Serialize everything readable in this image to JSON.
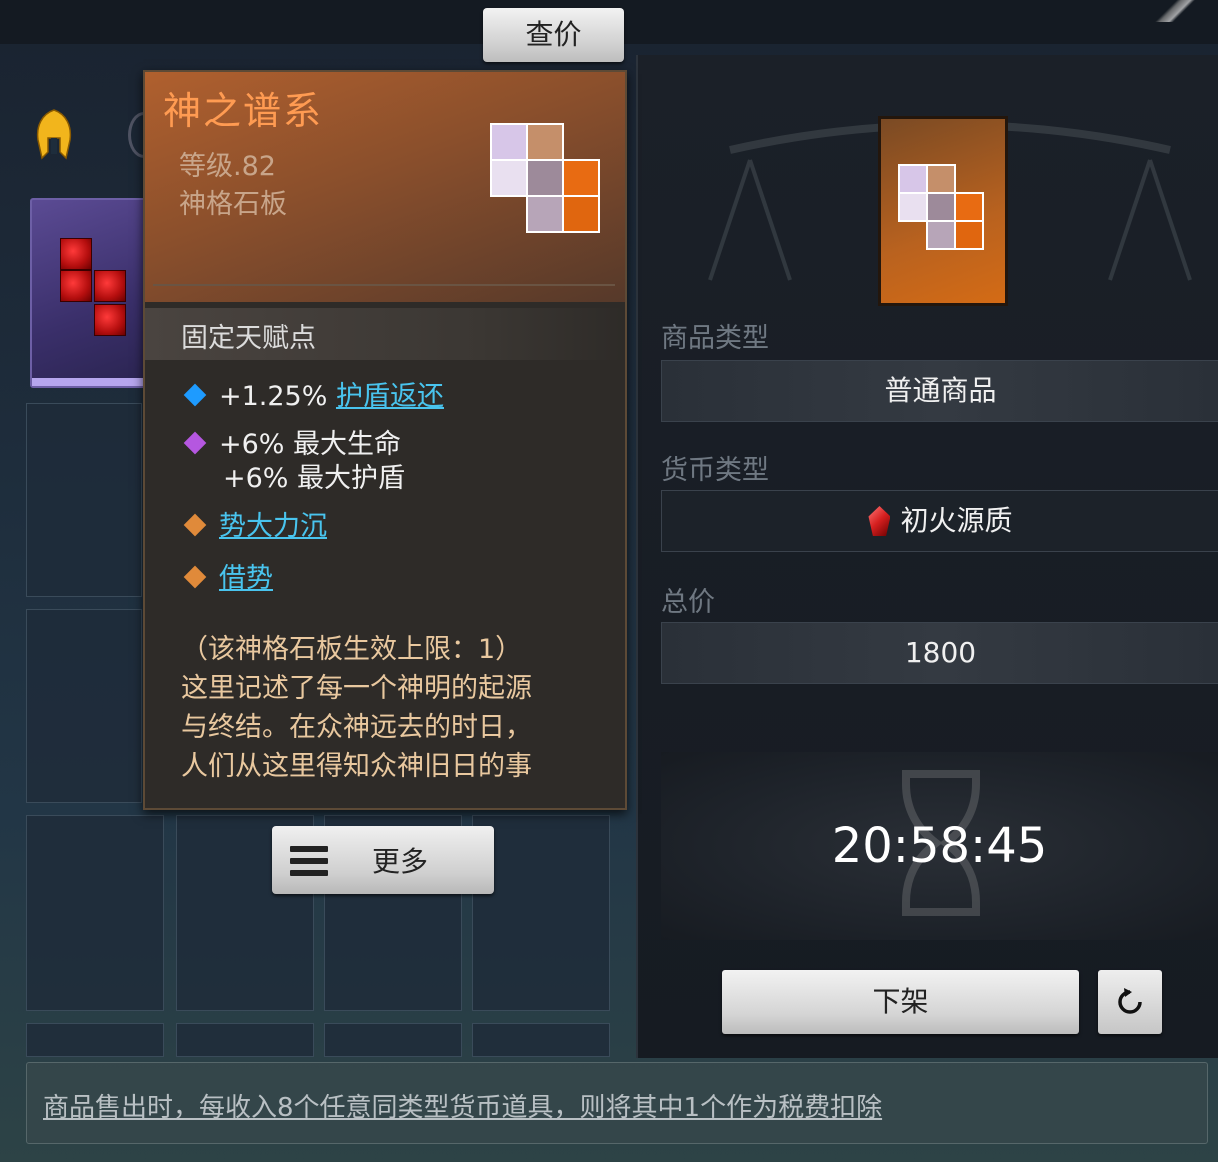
{
  "header": {
    "check_price_label": "查价"
  },
  "tooltip": {
    "title": "神之谱系",
    "level": "等级.82",
    "item_type": "神格石板",
    "section_title": "固定天赋点",
    "talents": [
      {
        "prefix": "+1.25% ",
        "link": "护盾返还",
        "color": "#1e9bff"
      },
      {
        "line1": "+6% 最大生命",
        "line2": "+6% 最大护盾",
        "color": "#b557e0"
      },
      {
        "link": "势大力沉",
        "color": "#e08a3a"
      },
      {
        "link": "借势",
        "color": "#e08a3a"
      }
    ],
    "description_lines": [
      "（该神格石板生效上限：1）",
      "这里记述了每一个神明的起源",
      "与终结。在众神远去的时日，",
      "人们从这里得知众神旧日的事"
    ]
  },
  "more_button": {
    "label": "更多",
    "icon": "menu-icon"
  },
  "listing": {
    "item_type_label": "商品类型",
    "item_type_value": "普通商品",
    "currency_label": "货币类型",
    "currency_value": "初火源质",
    "currency_icon": "red-crystal-icon",
    "total_label": "总价",
    "total_value": "1800",
    "timer": "20:58:45",
    "delist_label": "下架",
    "refresh_icon": "refresh-icon"
  },
  "footer": {
    "notice": "商品售出时，每收入8个任意同类型货币道具，则将其中1个作为税费扣除"
  },
  "colors": {
    "tooltip_title": "#ff9b52",
    "link": "#49c4ee",
    "desc": "#e9c89f",
    "card_orange": "#d46b15"
  }
}
